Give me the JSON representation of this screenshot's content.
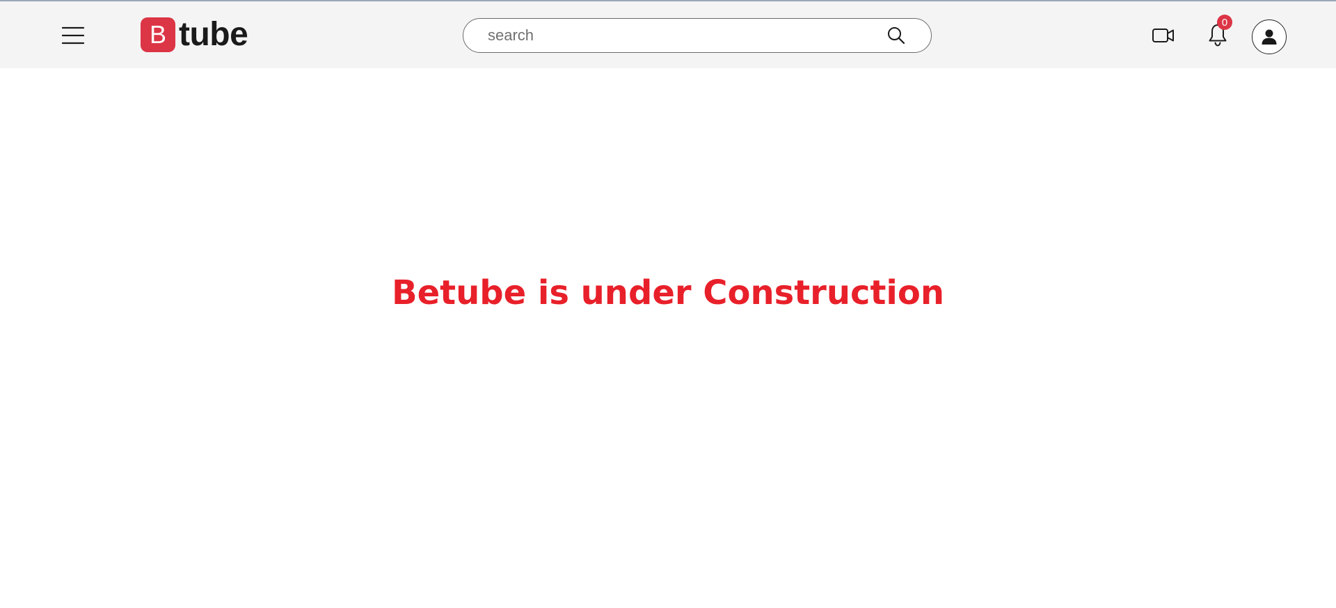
{
  "header": {
    "logo": {
      "badge_letter": "B",
      "text": "tube",
      "badge_color": "#dc3545"
    },
    "search": {
      "placeholder": "search",
      "value": ""
    },
    "notifications": {
      "count": "0"
    },
    "icons": {
      "menu": "hamburger-menu-icon",
      "search": "search-icon",
      "upload": "video-camera-icon",
      "notifications": "bell-icon",
      "account": "user-icon"
    },
    "background": "#f4f4f4"
  },
  "main": {
    "message": "Betube is under Construction",
    "message_color": "#e8202a"
  }
}
